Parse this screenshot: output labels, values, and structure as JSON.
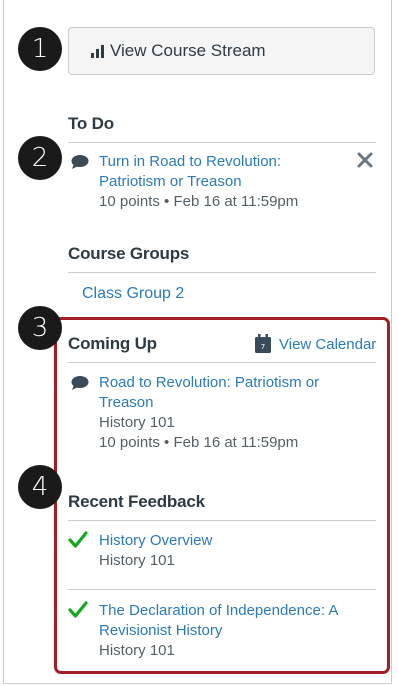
{
  "stream_button": {
    "label": "View Course Stream",
    "icon": "bar-chart-icon"
  },
  "todo": {
    "heading": "To Do",
    "item": {
      "title_line1": "Turn in Road to Revolution:",
      "title_line2": "Patriotism or Treason",
      "meta": "10 points • Feb 16 at 11:59pm"
    }
  },
  "course_groups": {
    "heading": "Course Groups",
    "items": [
      {
        "label": "Class Group 2"
      }
    ]
  },
  "coming_up": {
    "heading": "Coming Up",
    "calendar_link": "View Calendar",
    "item": {
      "title_line1": "Road to Revolution: Patriotism or",
      "title_line2": "Treason",
      "course": "History 101",
      "meta": "10 points • Feb 16 at 11:59pm"
    }
  },
  "recent_feedback": {
    "heading": "Recent Feedback",
    "items": [
      {
        "title_line1": "History Overview",
        "course": "History 101"
      },
      {
        "title_line1": "The Declaration of Independence: A",
        "title_line2": "Revisionist History",
        "course": "History 101"
      }
    ]
  },
  "callouts": [
    "1",
    "2",
    "3",
    "4"
  ],
  "colors": {
    "link": "#2b7abc",
    "check": "#13a81c",
    "highlight": "#a41e26",
    "badge": "#1a1a1a"
  }
}
